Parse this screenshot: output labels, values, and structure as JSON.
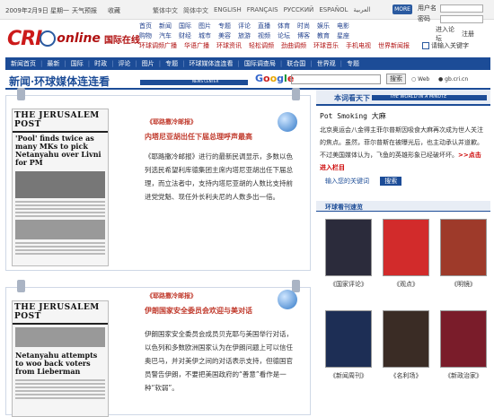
{
  "topbar": {
    "date": "2009年2月9日 星期一",
    "weather": "天气预报",
    "favorite": "收藏",
    "languages": [
      "繁体中文",
      "简体中文",
      "ENGLISH",
      "FRANÇAIS",
      "РУССКИЙ",
      "ESPAÑOL",
      "العربية"
    ],
    "more": "MORE"
  },
  "login": {
    "user_label": "用户名",
    "pass_label": "密码",
    "enter": "进入论坛",
    "register": "注册"
  },
  "logo": {
    "cri": "CRI",
    "online": "online",
    "cn": "国际在线"
  },
  "nav_rows": [
    [
      "首页",
      "新闻",
      "国际",
      "图片",
      "专题",
      "评论",
      "直播",
      "体育",
      "时尚",
      "娱乐",
      "电影"
    ],
    [
      "购物",
      "汽车",
      "财经",
      "城市",
      "美容",
      "旅游",
      "视频",
      "论坛",
      "博客",
      "教育",
      "星座"
    ]
  ],
  "nav_red_row": [
    "环球调频广播",
    "华语广播",
    "环球资讯",
    "轻松调频",
    "劲曲调频",
    "环球音乐",
    "手机电视",
    "世界新闻报"
  ],
  "search_mini": "请输入关键字",
  "main_nav": [
    "新闻首页",
    "最新",
    "国际",
    "时政",
    "评论",
    "图片",
    "专题",
    "环球媒体连连看",
    "国际调查局",
    "联合国",
    "世界观",
    "专题"
  ],
  "title": {
    "main": "新闻·环球媒体连连看",
    "band": "NEWS CENTER",
    "google": "Google",
    "button": "搜索",
    "radio1": "Web",
    "radio2": "gb.cri.cn"
  },
  "cards": [
    {
      "paper_title": "THE JERUSALEM POST",
      "paper_head": "'Pool' finds twice as many MKs to pick Netanyahu over Livni for PM",
      "source": "《耶路撒冷邮报》",
      "headline": "内塔尼亚胡出任下届总理呼声最高",
      "body": "《耶路撒冷邮报》进行的最新民调显示，多数以色列选民希望利库德集团主席内塔尼亚胡出任下届总理，而立法者中，支持内塔尼亚胡的人数比支持前进党党魁、现任外长利夫尼的人数多出一倍。"
    },
    {
      "paper_title": "THE JERUSALEM POST",
      "paper_head": "Netanyahu attempts to woo back voters from Lieberman",
      "source": "《耶路撒冷邮报》",
      "headline": "伊朗国家安全委员会欢迎与美对话",
      "body": "伊朗国家安全委员会成员贝克耶与美国举行对话，以色列和多数欧洲国家认为在伊朗问题上可以信任奥巴马，并对美伊之间的对话表示支持，但德国官员警告伊朗，不要把美国政府的“善意”看作是一种“软弱”。"
    }
  ],
  "right": {
    "section": "本词看天下",
    "band": "THE WORLD IN A MINUTE",
    "word": "Pot Smoking 大麻",
    "text": "北京奥运会八金得主菲尔普斯因吸食大麻再次成为世人关注的焦点。虽然，菲尔普斯在被曝光后，也主动承认并道歉。不过美国媒体认为，飞鱼的英雄形象已经破坏坏。",
    "more": ">>点击进入栏目",
    "keywords": "输入您的关键词",
    "kw_button": "搜索",
    "mag_title": "环球看刊速览",
    "covers": [
      {
        "name": "《国家评论》",
        "cap": "《国家评论》",
        "color": "#2b2b3b"
      },
      {
        "name": "《观点》",
        "cap": "《观点》",
        "color": "#d22b2b"
      },
      {
        "name": "《明镜》",
        "cap": "《明镜》",
        "color": "#9e3a2a"
      },
      {
        "name": "《新闻周刊》",
        "cap": "《新闻周刊》",
        "color": "#1d2e55"
      },
      {
        "name": "《名利场》",
        "cap": "《名利场》",
        "color": "#3a2c25"
      },
      {
        "name": "《新政治家》",
        "cap": "《新政治家》",
        "color": "#7a1c2a"
      }
    ]
  }
}
